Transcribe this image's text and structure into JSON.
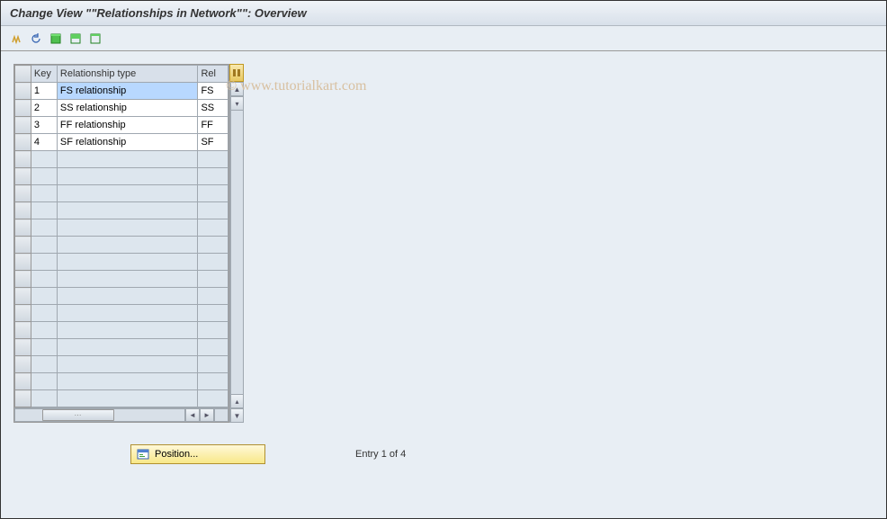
{
  "header": {
    "title": "Change View \"\"Relationships in Network\"\": Overview"
  },
  "toolbar": {
    "icons": [
      "change",
      "undo",
      "select-all",
      "select-block",
      "deselect-all"
    ]
  },
  "table": {
    "columns": {
      "key": "Key",
      "type": "Relationship type",
      "rel": "Rel"
    },
    "rows": [
      {
        "key": "1",
        "type": "FS relationship",
        "rel": "FS"
      },
      {
        "key": "2",
        "type": "SS relationship",
        "rel": "SS"
      },
      {
        "key": "3",
        "type": "FF relationship",
        "rel": "FF"
      },
      {
        "key": "4",
        "type": "SF relationship",
        "rel": "SF"
      }
    ],
    "empty_rows": 15
  },
  "footer": {
    "position_label": "Position...",
    "entry_status": "Entry 1 of 4"
  },
  "watermark": "© www.tutorialkart.com"
}
